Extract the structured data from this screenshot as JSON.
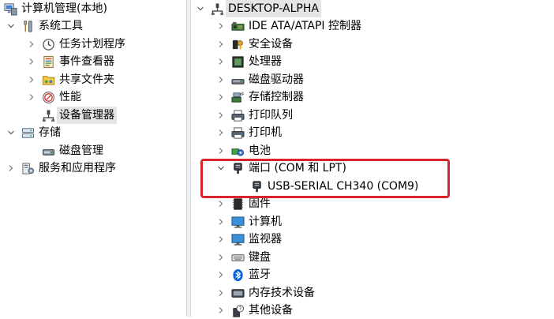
{
  "left_tree": {
    "root": "计算机管理(本地)",
    "system_tools": "系统工具",
    "task_scheduler": "任务计划程序",
    "event_viewer": "事件查看器",
    "shared_folders": "共享文件夹",
    "performance": "性能",
    "device_manager": "设备管理器",
    "storage": "存储",
    "disk_management": "磁盘管理",
    "services_apps": "服务和应用程序"
  },
  "device_tree": {
    "computer_name": "DESKTOP-ALPHA",
    "categories": [
      {
        "label": "IDE ATA/ATAPI 控制器",
        "icon": "ide-controller-icon"
      },
      {
        "label": "安全设备",
        "icon": "security-key-icon"
      },
      {
        "label": "处理器",
        "icon": "processor-icon"
      },
      {
        "label": "磁盘驱动器",
        "icon": "disk-drive-icon"
      },
      {
        "label": "存储控制器",
        "icon": "storage-controller-icon"
      },
      {
        "label": "打印队列",
        "icon": "print-queue-icon"
      },
      {
        "label": "打印机",
        "icon": "printer-icon"
      },
      {
        "label": "电池",
        "icon": "battery-icon"
      },
      {
        "label": "端口 (COM 和 LPT)",
        "icon": "port-icon",
        "expanded": true
      },
      {
        "label": "固件",
        "icon": "firmware-icon"
      },
      {
        "label": "计算机",
        "icon": "computer-icon"
      },
      {
        "label": "监视器",
        "icon": "monitor-icon"
      },
      {
        "label": "键盘",
        "icon": "keyboard-icon"
      },
      {
        "label": "蓝牙",
        "icon": "bluetooth-icon"
      },
      {
        "label": "内存技术设备",
        "icon": "memory-device-icon"
      },
      {
        "label": "其他设备",
        "icon": "other-devices-icon"
      }
    ],
    "port_child": "USB-SERIAL CH340 (COM9)"
  },
  "colors": {
    "highlight": "#d9252a",
    "selection": "#e5e5e5",
    "bluetooth": "#0a64d8",
    "monitor": "#3a8fd8"
  }
}
